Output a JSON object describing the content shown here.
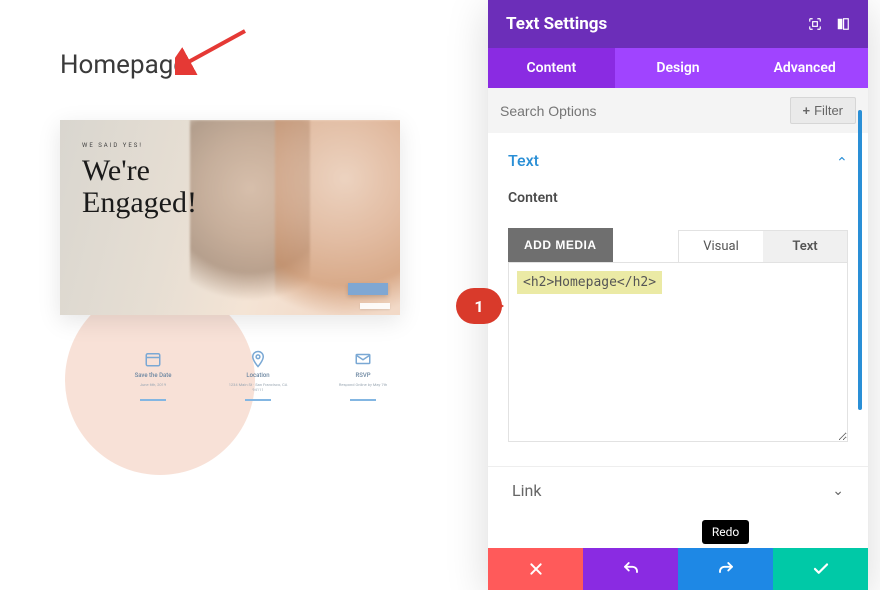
{
  "preview": {
    "page_title": "Homepage",
    "hero_eyebrow": "WE SAID YES!",
    "hero_headline_line1": "We're",
    "hero_headline_line2": "Engaged!",
    "features": [
      {
        "label": "Save the Date",
        "sub": "June 6th, 2019"
      },
      {
        "label": "Location",
        "sub": "1234 Main St · San Francisco, CA 94111"
      },
      {
        "label": "RSVP",
        "sub": "Respond Online by May 7th"
      }
    ]
  },
  "panel": {
    "title": "Text Settings",
    "tabs": {
      "content": "Content",
      "design": "Design",
      "advanced": "Advanced"
    },
    "search_placeholder": "Search Options",
    "filter_label": "Filter",
    "section_text_title": "Text",
    "content_label": "Content",
    "add_media_label": "ADD MEDIA",
    "editor_tabs": {
      "visual": "Visual",
      "text": "Text"
    },
    "editor_value": "<h2>Homepage</h2>",
    "section_link_title": "Link",
    "tooltip_redo": "Redo"
  },
  "callout": {
    "number": "1"
  }
}
